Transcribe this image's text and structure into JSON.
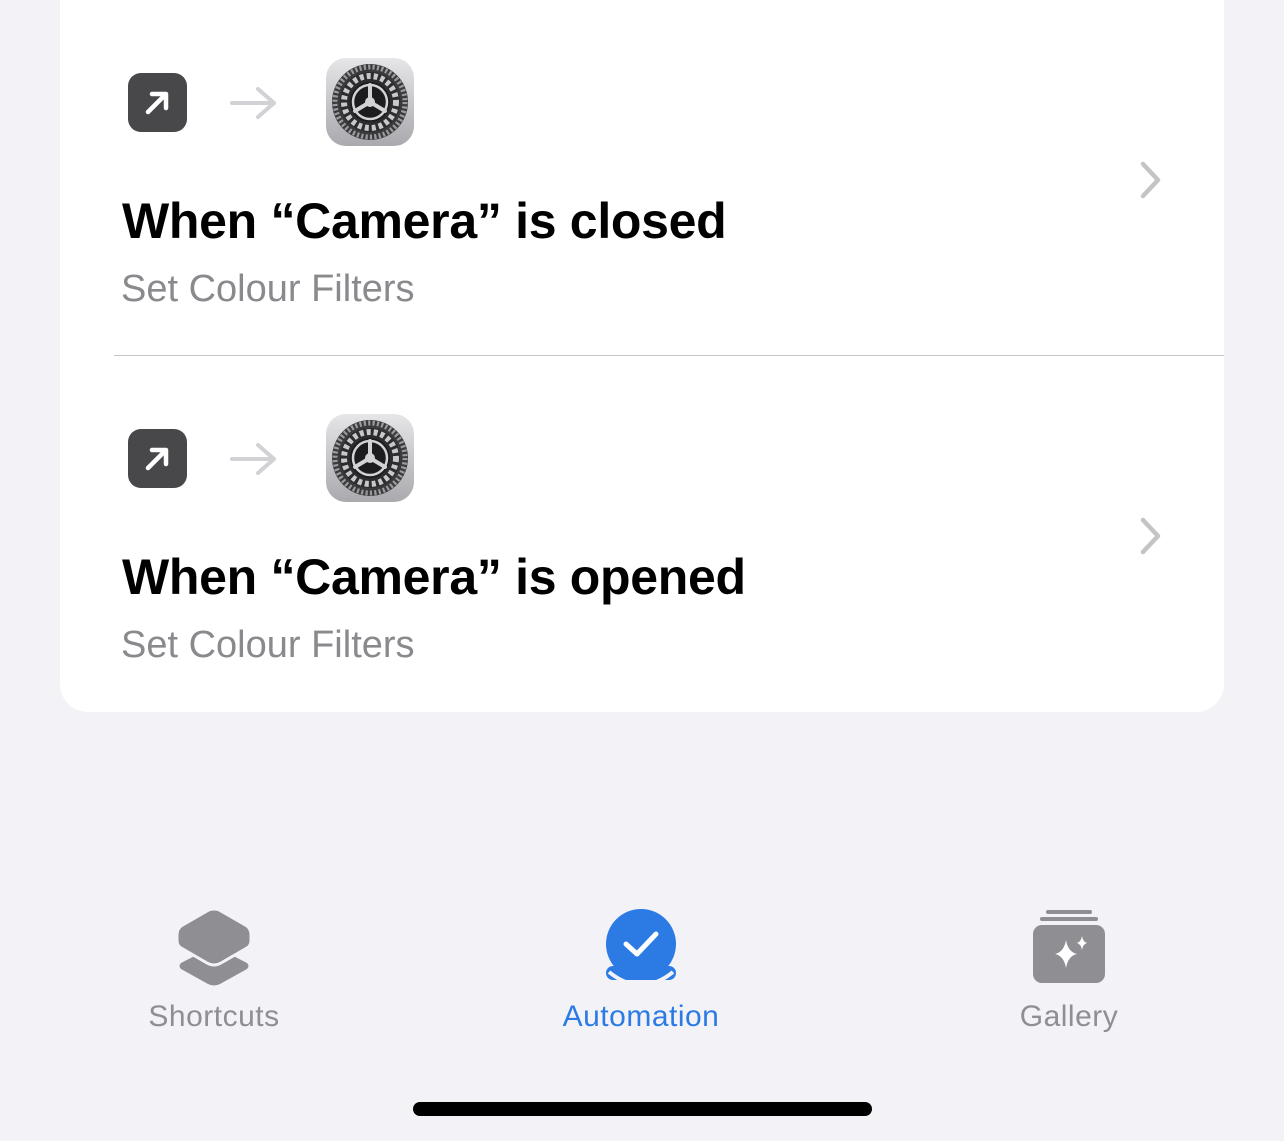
{
  "automations": [
    {
      "trigger_icon": "arrow-up-right-icon",
      "flow_icon": "right-arrow-icon",
      "action_icon": "settings-gear-icon",
      "title": "When “Camera” is closed",
      "subtitle": "Set Colour Filters"
    },
    {
      "trigger_icon": "arrow-up-right-icon",
      "flow_icon": "right-arrow-icon",
      "action_icon": "settings-gear-icon",
      "title": "When “Camera” is opened",
      "subtitle": "Set Colour Filters"
    }
  ],
  "tabbar": {
    "tabs": [
      {
        "label": "Shortcuts",
        "icon": "layers-icon",
        "active": false
      },
      {
        "label": "Automation",
        "icon": "clock-check-icon",
        "active": true
      },
      {
        "label": "Gallery",
        "icon": "sparkle-stack-icon",
        "active": false
      }
    ]
  },
  "colors": {
    "accent": "#2c7be5",
    "inactive_tab": "#8e8e93",
    "background": "#f2f2f7",
    "card": "#ffffff",
    "subtitle": "#8a8a8e",
    "trigger_icon_bg": "#48484a"
  }
}
